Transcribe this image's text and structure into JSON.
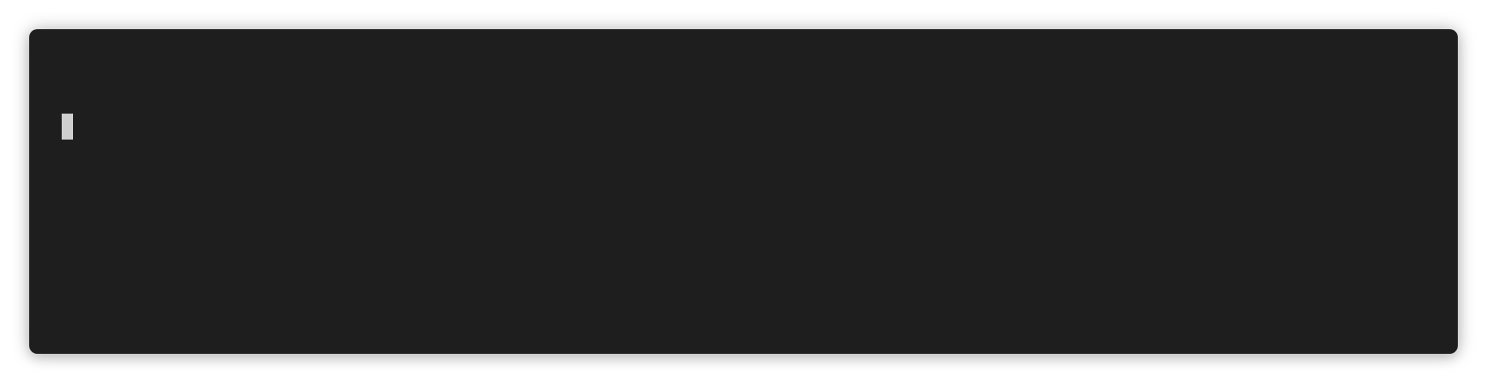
{
  "terminal": {
    "lines": [
      {
        "text": ""
      }
    ],
    "colors": {
      "background": "#1e1e1e",
      "cursor": "#cfcfcf",
      "text": "#d4d4d4"
    }
  }
}
